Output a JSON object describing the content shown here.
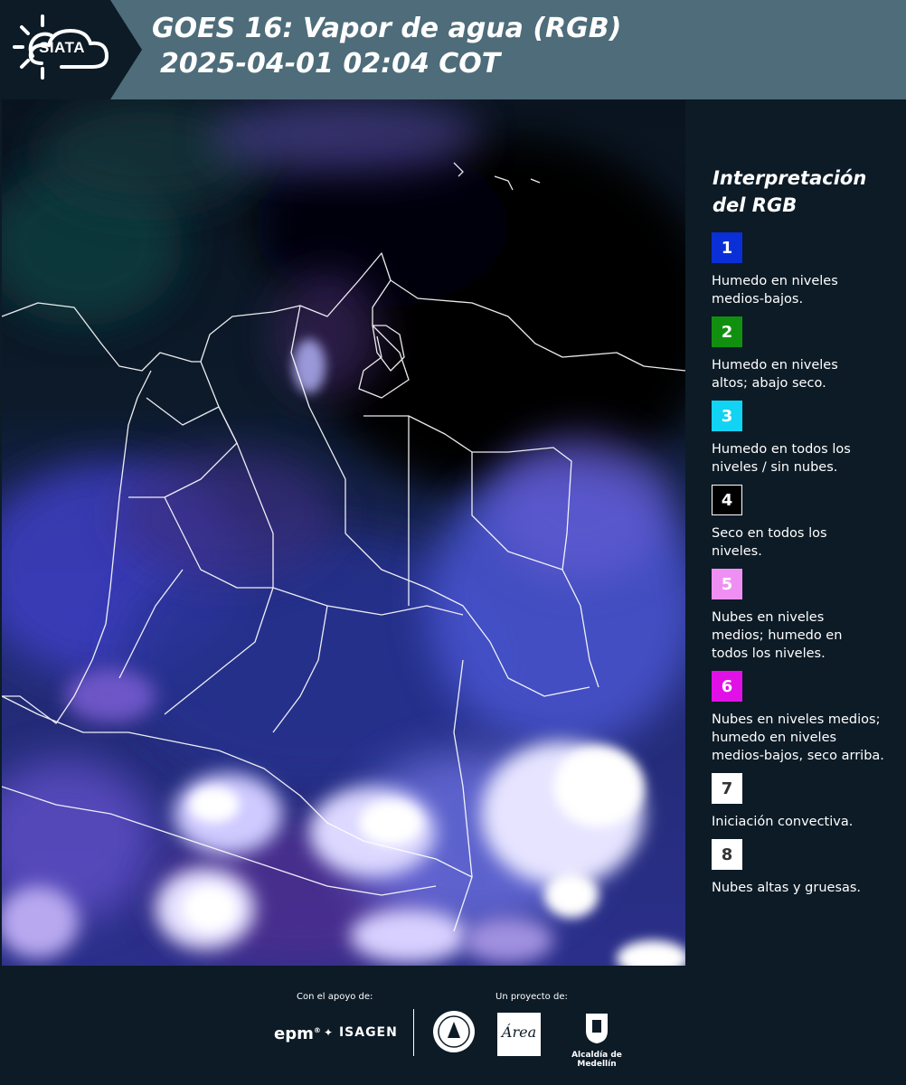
{
  "header": {
    "logo_text": "SIATA",
    "title_line1": "GOES 16: Vapor de agua (RGB)",
    "title_line2": "2025-04-01 02:04 COT",
    "band_color": "#4e6c7a"
  },
  "legend": {
    "title": "Interpretación del RGB",
    "items": [
      {
        "number": "1",
        "text": "Humedo en niveles medios-bajos.",
        "color": "#0a2fd6"
      },
      {
        "number": "2",
        "text": "Humedo en niveles altos; abajo seco.",
        "color": "#119010"
      },
      {
        "number": "3",
        "text": "Humedo en todos los niveles / sin nubes.",
        "color": "#12d3f3"
      },
      {
        "number": "4",
        "text": "Seco en todos los niveles.",
        "color": "#000000"
      },
      {
        "number": "5",
        "text": "Nubes en niveles medios; humedo en todos los niveles.",
        "color": "#f08ff3"
      },
      {
        "number": "6",
        "text": "Nubes en niveles medios; humedo en niveles medios-bajos, seco arriba.",
        "color": "#e010e6"
      },
      {
        "number": "7",
        "text": "Iniciación convectiva.",
        "color": "#ffffff"
      },
      {
        "number": "8",
        "text": "Nubes altas y gruesas.",
        "color": "#ffffff"
      }
    ]
  },
  "footer": {
    "support_label": "Con el apoyo de:",
    "project_label": "Un proyecto de:",
    "epm_text": "epm",
    "isagen_text": "ISAGEN",
    "metropolitana_text": "Área",
    "medellin_text": "Alcaldía de Medellín"
  }
}
